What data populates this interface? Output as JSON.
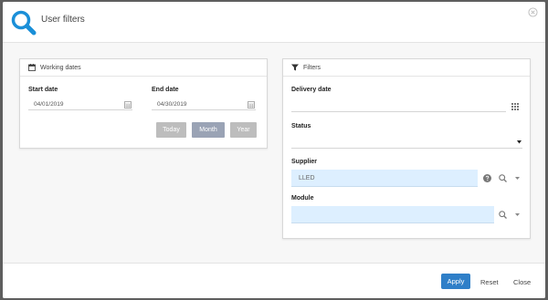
{
  "dialog": {
    "title": "User filters"
  },
  "working_dates": {
    "heading": "Working dates",
    "start_label": "Start date",
    "start_value": "04/01/2019",
    "end_label": "End date",
    "end_value": "04/30/2019",
    "buttons": {
      "today": "Today",
      "month": "Month",
      "year": "Year"
    },
    "active_button": "Month"
  },
  "filters": {
    "heading": "Filters",
    "delivery_label": "Delivery date",
    "delivery_value": "",
    "status_label": "Status",
    "status_value": "",
    "supplier_label": "Supplier",
    "supplier_value": "LLED",
    "module_label": "Module",
    "module_value": ""
  },
  "footer": {
    "apply": "Apply",
    "reset": "Reset",
    "close": "Close"
  },
  "colors": {
    "accent": "#2f7fc8",
    "field_bg": "#ddefff",
    "logo": "#1a8fd8",
    "active_button": "#9aa3b5"
  },
  "icons": [
    "search-logo-icon",
    "close-circle-icon",
    "calendar-icon",
    "filter-funnel-icon",
    "grid-icon",
    "dropdown-arrow-icon",
    "help-icon",
    "search-icon",
    "chevron-down-icon"
  ]
}
